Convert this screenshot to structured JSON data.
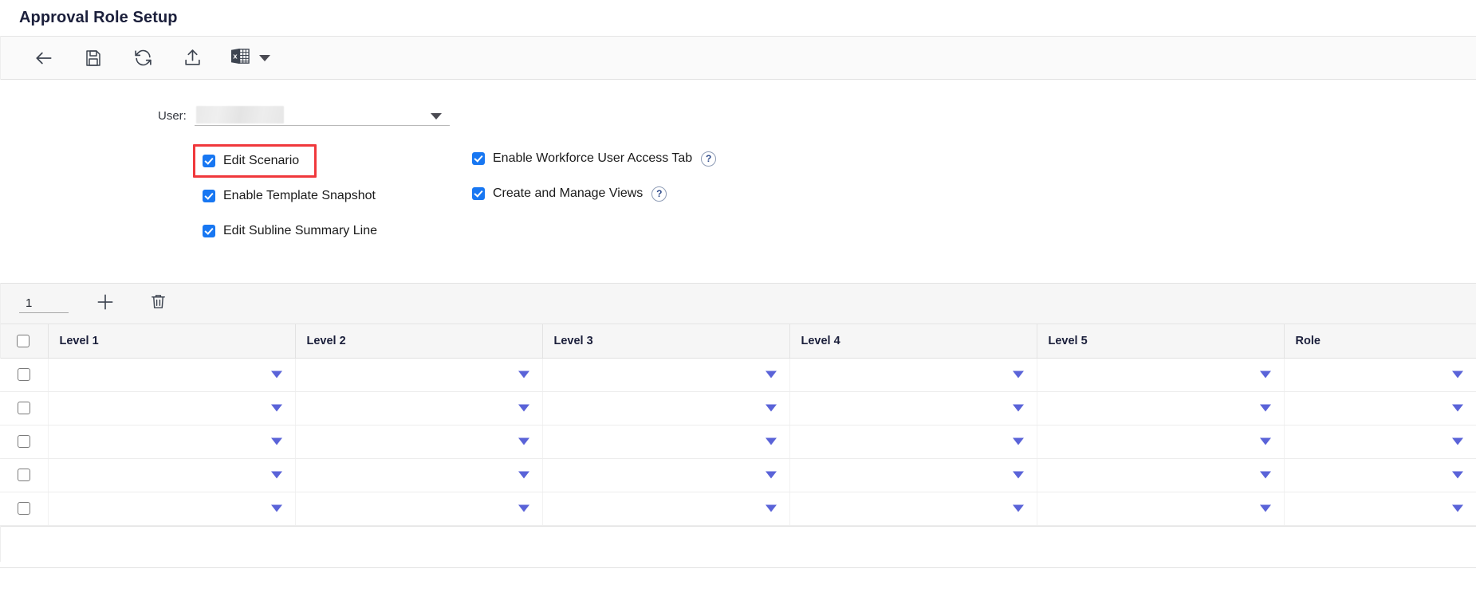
{
  "header": {
    "title": "Approval Role Setup"
  },
  "toolbar": {
    "items": [
      {
        "name": "back-button",
        "icon": "arrow-left-icon",
        "label": "Back"
      },
      {
        "name": "save-button",
        "icon": "save-floppy-icon",
        "label": "Save"
      },
      {
        "name": "refresh-button",
        "icon": "refresh-icon",
        "label": "Refresh"
      },
      {
        "name": "upload-button",
        "icon": "upload-icon",
        "label": "Upload"
      },
      {
        "name": "export-excel-button",
        "icon": "excel-icon",
        "label": "Export to Excel"
      }
    ]
  },
  "form": {
    "user_label": "User:",
    "user_value": "",
    "user_placeholder": "",
    "left_checkboxes": [
      {
        "label": "Edit Scenario",
        "checked": true,
        "highlighted": true,
        "help": false
      },
      {
        "label": "Enable Template Snapshot",
        "checked": true,
        "highlighted": false,
        "help": false
      },
      {
        "label": "Edit Subline Summary Line",
        "checked": true,
        "highlighted": false,
        "help": false
      }
    ],
    "right_checkboxes": [
      {
        "label": "Enable Workforce User Access Tab",
        "checked": true,
        "highlighted": false,
        "help": true,
        "help_glyph": "?"
      },
      {
        "label": "Create and Manage Views",
        "checked": true,
        "highlighted": false,
        "help": true,
        "help_glyph": "?"
      }
    ]
  },
  "grid_toolbar": {
    "row_count_value": "1",
    "row_count_placeholder": "",
    "add_row_label": "Add Row",
    "delete_row_label": "Delete Row"
  },
  "table": {
    "columns": [
      "",
      "Level 1",
      "Level 2",
      "Level 3",
      "Level 4",
      "Level 5",
      "Role"
    ],
    "header_select_all_checked": false,
    "rows": [
      {
        "selected": false,
        "level1": "",
        "level2": "",
        "level3": "",
        "level4": "",
        "level5": "",
        "role": ""
      },
      {
        "selected": false,
        "level1": "",
        "level2": "",
        "level3": "",
        "level4": "",
        "level5": "",
        "role": ""
      },
      {
        "selected": false,
        "level1": "",
        "level2": "",
        "level3": "",
        "level4": "",
        "level5": "",
        "role": ""
      },
      {
        "selected": false,
        "level1": "",
        "level2": "",
        "level3": "",
        "level4": "",
        "level5": "",
        "role": ""
      },
      {
        "selected": false,
        "level1": "",
        "level2": "",
        "level3": "",
        "level4": "",
        "level5": "",
        "role": ""
      }
    ]
  },
  "colors": {
    "checkbox_accent": "#1877f2",
    "dropdown_caret": "#5a63d8",
    "highlight_border": "#f0383c",
    "header_text": "#1b1f3b",
    "toolbar_bg": "#fafafa"
  }
}
